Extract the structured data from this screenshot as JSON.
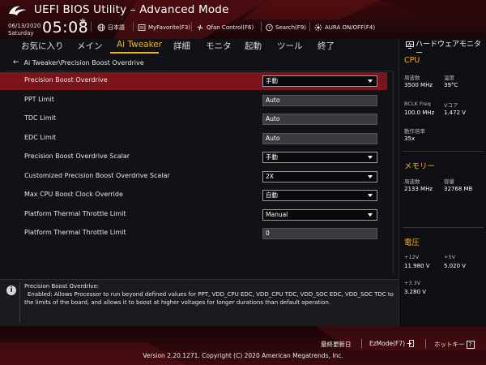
{
  "header": {
    "title": "UEFI BIOS Utility – Advanced Mode",
    "date": "06/13/2020",
    "day": "Saturday",
    "time": "05:08",
    "tools": {
      "language": "日本語",
      "myfavorite": "MyFavorite(F3)",
      "qfan": "Qfan Control(F6)",
      "search": "Search(F9)",
      "aura": "AURA ON/OFF(F4)"
    }
  },
  "menu": {
    "items": [
      "お気に入り",
      "メイン",
      "Ai Tweaker",
      "詳細",
      "モニタ",
      "起動",
      "ツール",
      "終了"
    ],
    "active_index": 2
  },
  "breadcrumb": "Ai Tweaker\\Precision Boost Overdrive",
  "settings": [
    {
      "label": "Precision Boost Overdrive",
      "type": "select",
      "value": "手動",
      "selected": true
    },
    {
      "label": "PPT Limit",
      "type": "text",
      "value": "Auto"
    },
    {
      "label": "TDC Limit",
      "type": "text",
      "value": "Auto"
    },
    {
      "label": "EDC Limit",
      "type": "text",
      "value": "Auto"
    },
    {
      "label": "Precision Boost Overdrive Scalar",
      "type": "select",
      "value": "手動"
    },
    {
      "label": "Customized Precision Boost Overdrive Scalar",
      "type": "select",
      "value": "2X"
    },
    {
      "label": "Max CPU Boost Clock Override",
      "type": "select",
      "value": "自動"
    },
    {
      "label": "Platform Thermal Throttle Limit",
      "type": "select",
      "value": "Manual"
    },
    {
      "label": "Platform Thermal Throttle Limit",
      "type": "text",
      "value": "0"
    }
  ],
  "hw_monitor": {
    "title": "ハードウェアモニター",
    "cpu": {
      "heading": "CPU",
      "freq_label": "周波数",
      "freq_value": "3500 MHz",
      "temp_label": "温度",
      "temp_value": "39°C",
      "bclk_label": "BCLK Freq",
      "bclk_value": "100.0 MHz",
      "vcore_label": "Vコア",
      "vcore_value": "1.472 V",
      "ratio_label": "動作倍率",
      "ratio_value": "35x"
    },
    "memory": {
      "heading": "メモリー",
      "freq_label": "周波数",
      "freq_value": "2133 MHz",
      "cap_label": "容量",
      "cap_value": "32768 MB"
    },
    "voltage": {
      "heading": "電圧",
      "v12_label": "+12V",
      "v12_value": "11.980 V",
      "v5_label": "+5V",
      "v5_value": "5.020 V",
      "v33_label": "+3.3V",
      "v33_value": "3.280 V"
    }
  },
  "info": {
    "title": "Precision Boost Overdrive:",
    "text": "Enabled: Allows Processor to run beyond defined values for PPT, VDD_CPU EDC, VDD_CPU TDC, VDD_SOC EDC, VDD_SOC TDC to the limits of the board, and allows it to boost at higher voltages for longer durations than default operation."
  },
  "footer": {
    "last_modified": "最終更新日",
    "ezmode": "EzMode(F7)",
    "hotkeys": "ホットキー",
    "hotkeys_key": "?",
    "version": "Version 2.20.1271. Copyright (C) 2020 American Megatrends, Inc."
  },
  "colors": {
    "accent": "#f2b31e",
    "selected_row": "#7b151b",
    "header_red": "#3a0a0e"
  }
}
